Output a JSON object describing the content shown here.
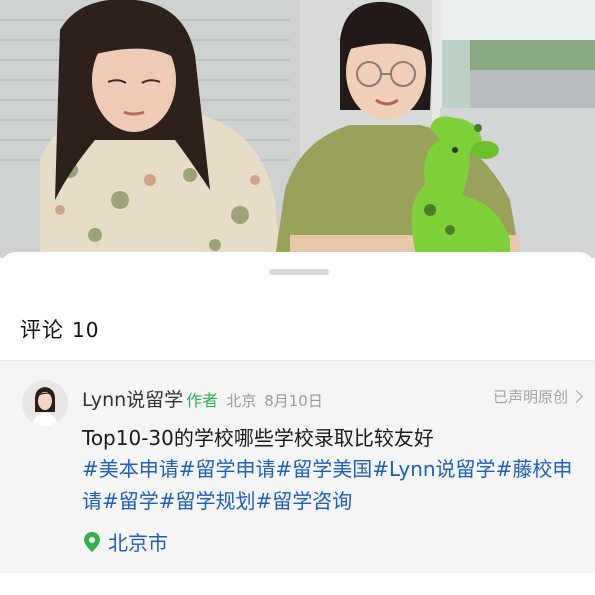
{
  "comments": {
    "label": "评论",
    "count": "10"
  },
  "post": {
    "author": "Lynn说留学",
    "author_badge": "作者",
    "location_meta": "北京",
    "date": "8月10日",
    "original_claim": "已声明原创",
    "title": "Top10-30的学校哪些学校录取比较友好",
    "hashtags": [
      "#美本申请",
      "#留学申请",
      "#留学美国",
      "#Lynn说留学",
      "#藤校申请",
      "#留学",
      "#留学规划",
      "#留学咨询"
    ],
    "location": "北京市"
  },
  "colors": {
    "accent_green": "#2fb24c",
    "link_blue": "#1f5fb8",
    "card_bg": "#f5f5f5"
  },
  "icons": {
    "avatar": "avatar-image",
    "chevron": "chevron-right-icon",
    "location": "location-pin-icon"
  }
}
